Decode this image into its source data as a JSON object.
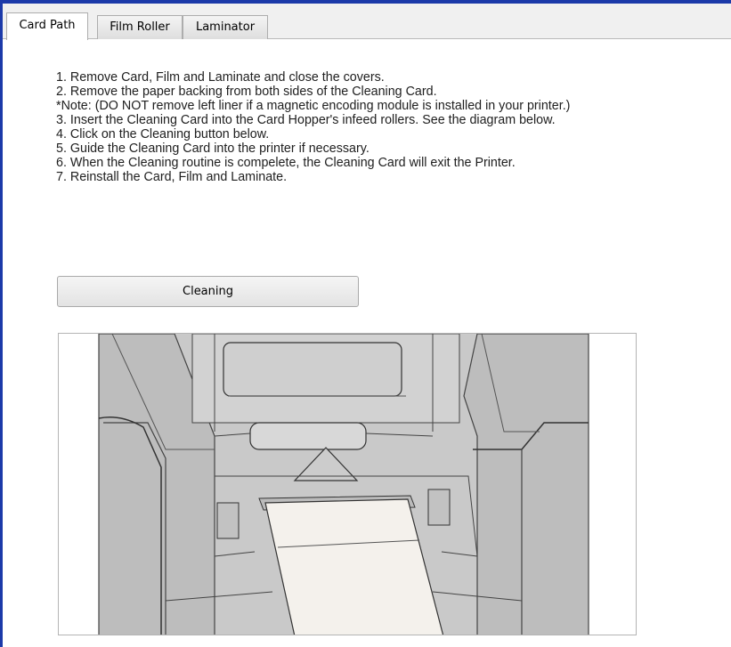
{
  "tabs": [
    {
      "label": "Card Path",
      "active": true
    },
    {
      "label": "Film Roller",
      "active": false
    },
    {
      "label": "Laminator",
      "active": false
    }
  ],
  "instructions": [
    "1. Remove Card, Film and Laminate and close the covers.",
    "2. Remove the paper backing from both sides of the Cleaning Card.",
    "*Note: (DO NOT remove left liner if a magnetic encoding module is installed in your printer.)",
    "3. Insert the Cleaning Card into the Card Hopper's infeed rollers. See the diagram below.",
    "4. Click on the Cleaning button below.",
    "5. Guide the Cleaning Card into the printer if necessary.",
    "6. When the Cleaning routine is compelete, the Cleaning Card will exit the Printer.",
    "7. Reinstall the Card, Film and Laminate."
  ],
  "cleaning_button": {
    "label": "Cleaning"
  },
  "colors": {
    "accent": "#1c3aa9",
    "diagram_gray": "#c8c8c8",
    "card": "#f4f1ec"
  }
}
